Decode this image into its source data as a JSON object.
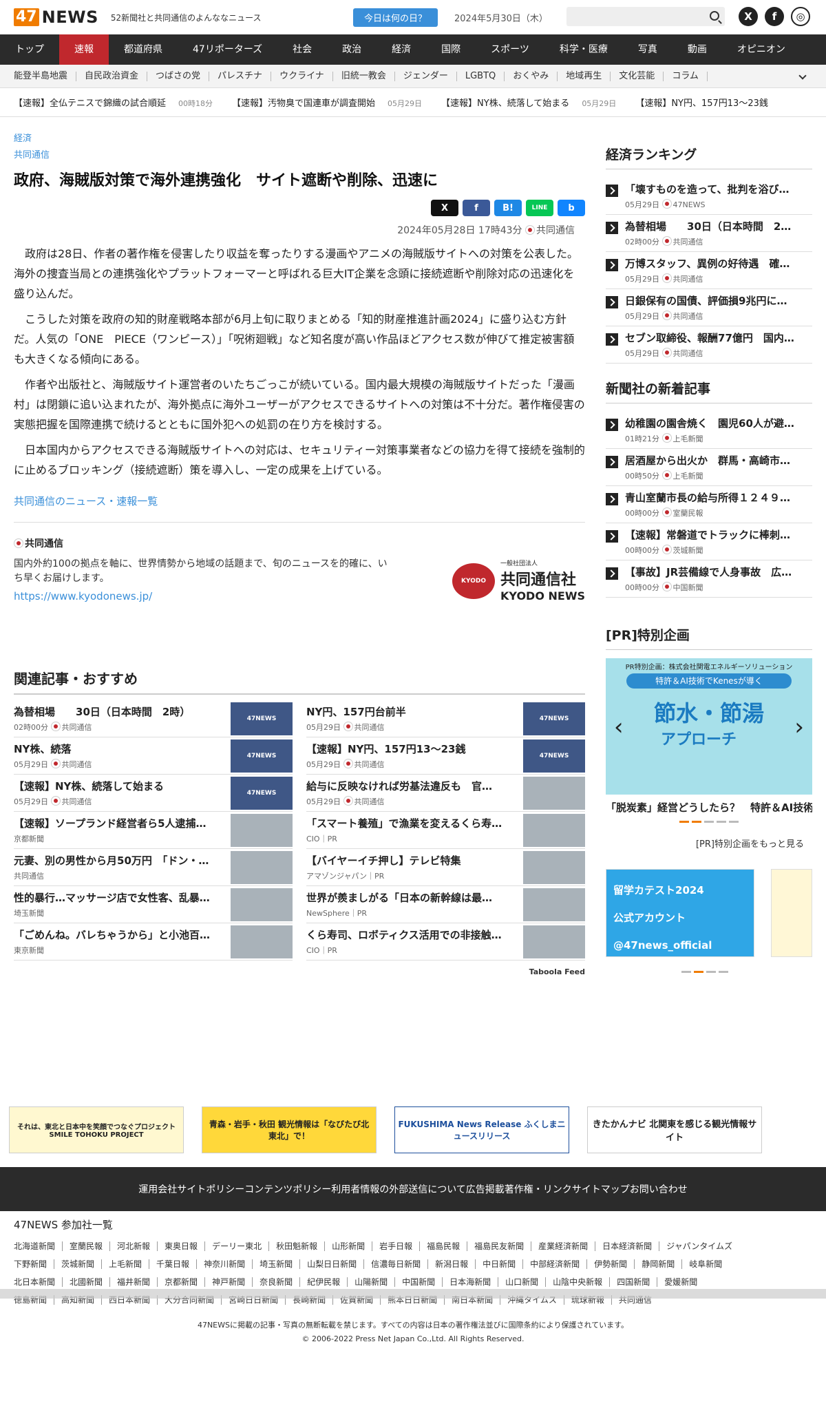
{
  "header": {
    "logo_num": "47",
    "logo_text": "NEWS",
    "tagline": "52新聞社と共同通信のよんななニュース",
    "today_btn": "今日は何の日？",
    "date": "2024年5月30日（木）"
  },
  "nav": [
    "トップ",
    "速報",
    "都道府県",
    "47リポーターズ",
    "社会",
    "政治",
    "経済",
    "国際",
    "スポーツ",
    "科学・医療",
    "写真",
    "動画",
    "オピニオン"
  ],
  "subnav": [
    "能登半島地震",
    "自民政治資金",
    "つばさの党",
    "パレスチナ",
    "ウクライナ",
    "旧統一教会",
    "ジェンダー",
    "LGBTQ",
    "おくやみ",
    "地域再生",
    "文化芸能",
    "コラム"
  ],
  "ticker": [
    {
      "t": "【速報】全仏テニスで錦織の試合順延",
      "m": "00時18分"
    },
    {
      "t": "【速報】汚物臭で国連車が調査開始",
      "m": "05月29日"
    },
    {
      "t": "【速報】NY株、続落して始まる",
      "m": "05月29日"
    },
    {
      "t": "【速報】NY円、157円13〜23銭",
      "m": ""
    }
  ],
  "article": {
    "category": "経済",
    "source_link": "共同通信",
    "title": "政府、海賊版対策で海外連携強化　サイト遮断や削除、迅速に",
    "date": "2024年05月28日 17時43分",
    "source": "共同通信",
    "paragraphs": [
      "政府は28日、作者の著作権を侵害したり収益を奪ったりする漫画やアニメの海賊版サイトへの対策を公表した。海外の捜査当局との連携強化やプラットフォーマーと呼ばれる巨大IT企業を念頭に接続遮断や削除対応の迅速化を盛り込んだ。",
      "こうした対策を政府の知的財産戦略本部が6月上旬に取りまとめる「知的財産推進計画2024」に盛り込む方針だ。人気の「ONE　PIECE（ワンピース）」「呪術廻戦」など知名度が高い作品ほどアクセス数が伸びて推定被害額も大きくなる傾向にある。",
      "作者や出版社と、海賊版サイト運営者のいたちごっこが続いている。国内最大規模の海賊版サイトだった「漫画村」は閉鎖に追い込まれたが、海外拠点に海外ユーザーがアクセスできるサイトへの対策は不十分だ。著作権侵害の実態把握を国際連携で続けるとともに国外犯への処罰の在り方を検討する。",
      "日本国内からアクセスできる海賊版サイトへの対応は、セキュリティー対策事業者などの協力を得て接続を強制的に止めるブロッキング（接続遮断）策を導入し、一定の成果を上げている。"
    ],
    "more_link": "共同通信のニュース・速報一覧"
  },
  "source_box": {
    "name": "共同通信",
    "desc": "国内外約100の拠点を軸に、世界情勢から地域の話題まで、旬のニュースを的確に、いち早くお届けします。",
    "url": "https://www.kyodonews.jp/",
    "logo_badge": "KYODO",
    "logo_small": "一般社団法人",
    "logo_jp": "共同通信社",
    "logo_en": "KYODO NEWS"
  },
  "share": {
    "x": "X",
    "fb": "f",
    "hb": "B!",
    "line": "LINE",
    "bsky": "b"
  },
  "related": {
    "title": "関連記事・おすすめ",
    "items": [
      {
        "t": "為替相場　　30日（日本時間　2時）",
        "m": "02時00分",
        "s": "共同通信"
      },
      {
        "t": "NY円、157円台前半",
        "m": "05月29日",
        "s": "共同通信"
      },
      {
        "t": "NY株、続落",
        "m": "05月29日",
        "s": "共同通信"
      },
      {
        "t": "【速報】NY円、157円13〜23銭",
        "m": "05月29日",
        "s": "共同通信"
      },
      {
        "t": "【速報】NY株、続落して始まる",
        "m": "05月29日",
        "s": "共同通信"
      },
      {
        "t": "給与に反映なければ労基法違反も　官…",
        "m": "05月29日",
        "s": "共同通信"
      },
      {
        "t": "【速報】ソープランド経営者ら5人逮捕…",
        "m": "",
        "s": "京都新聞"
      },
      {
        "t": "「スマート養殖」で漁業を変えるくら寿…",
        "m": "",
        "s": "CIO｜PR"
      },
      {
        "t": "元妻、別の男性から月50万円　「ドン・…",
        "m": "",
        "s": "共同通信"
      },
      {
        "t": "【バイヤーイチ押し】テレビ特集",
        "m": "",
        "s": "アマゾンジャパン｜PR"
      },
      {
        "t": "性的暴行…マッサージ店で女性客、乱暴…",
        "m": "",
        "s": "埼玉新聞"
      },
      {
        "t": "世界が羨ましがる「日本の新幹線は最…",
        "m": "",
        "s": "NewSphere｜PR"
      },
      {
        "t": "「ごめんね。バレちゃうから」と小池百…",
        "m": "",
        "s": "東京新聞"
      },
      {
        "t": "くら寿司、ロボティクス活用での非接触…",
        "m": "",
        "s": "CIO｜PR"
      }
    ],
    "taboola": "Taboola Feed"
  },
  "ranking": {
    "title": "経済ランキング",
    "items": [
      {
        "t": "「壊すものを造って、批判を浴び…",
        "m": "05月29日",
        "s": "47NEWS"
      },
      {
        "t": "為替相場　　30日（日本時間　2…",
        "m": "02時00分",
        "s": "共同通信"
      },
      {
        "t": "万博スタッフ、異例の好待遇　確…",
        "m": "05月29日",
        "s": "共同通信"
      },
      {
        "t": "日銀保有の国債、評価損9兆円に…",
        "m": "05月29日",
        "s": "共同通信"
      },
      {
        "t": "セブン取締役、報酬77億円　国内…",
        "m": "05月29日",
        "s": "共同通信"
      }
    ]
  },
  "newest": {
    "title": "新聞社の新着記事",
    "items": [
      {
        "t": "幼稚園の園舎焼く　園児60人が避…",
        "m": "01時21分",
        "s": "上毛新聞"
      },
      {
        "t": "居酒屋から出火か　群馬・高崎市…",
        "m": "00時50分",
        "s": "上毛新聞"
      },
      {
        "t": "青山室蘭市長の給与所得１２４９…",
        "m": "00時00分",
        "s": "室蘭民報"
      },
      {
        "t": "【速報】常磐道でトラックに棒刺…",
        "m": "00時00分",
        "s": "茨城新聞"
      },
      {
        "t": "【事故】JR芸備線で人身事故　広…",
        "m": "00時00分",
        "s": "中国新聞"
      }
    ]
  },
  "pr": {
    "title": "[PR]特別企画",
    "top": "PR特別企画：株式会社関電エネルギーソリューション",
    "band": "特許＆AI技術でKenesが導く",
    "big": "節水・節湯",
    "sm": "アプローチ",
    "caption": "「脱炭素」経営どうしたら？　特許＆AI技術でKenesが導く節水・節湯ア…",
    "more": "[PR]特別企画をもっと見る"
  },
  "side_banners": [
    "留学カテスト2024",
    "公式アカウント @47news_official"
  ],
  "footer_banners": [
    "それは、東北と日本中を笑顔でつなぐプロジェクト SMILE TOHOKU PROJECT",
    "青森・岩手・秋田 観光情報は「なびたび北東北」で！",
    "FUKUSHIMA News Release ふくしまニュースリリース",
    "きたかんナビ 北関東を感じる観光情報サイト"
  ],
  "footer_links": [
    "運用会社",
    "サイトポリシー",
    "コンテンツポリシー",
    "利用者情報の外部送信について",
    "広告掲載",
    "著作権・リンク",
    "サイトマップ",
    "お問い合わせ"
  ],
  "members": {
    "title": "47NEWS 参加社一覧",
    "rows": [
      [
        "北海道新聞",
        "室蘭民報",
        "河北新報",
        "東奥日報",
        "デーリー東北",
        "秋田魁新報",
        "山形新聞",
        "岩手日報",
        "福島民報",
        "福島民友新聞",
        "産業経済新聞",
        "日本経済新聞",
        "ジャパンタイムズ"
      ],
      [
        "下野新聞",
        "茨城新聞",
        "上毛新聞",
        "千葉日報",
        "神奈川新聞",
        "埼玉新聞",
        "山梨日日新聞",
        "信濃毎日新聞",
        "新潟日報",
        "中日新聞",
        "中部経済新聞",
        "伊勢新聞",
        "静岡新聞",
        "岐阜新聞"
      ],
      [
        "北日本新聞",
        "北國新聞",
        "福井新聞",
        "京都新聞",
        "神戸新聞",
        "奈良新聞",
        "紀伊民報",
        "山陽新聞",
        "中国新聞",
        "日本海新聞",
        "山口新聞",
        "山陰中央新報",
        "四国新聞",
        "愛媛新聞"
      ],
      [
        "徳島新聞",
        "高知新聞",
        "西日本新聞",
        "大分合同新聞",
        "宮崎日日新聞",
        "長崎新聞",
        "佐賀新聞",
        "熊本日日新聞",
        "南日本新聞",
        "沖縄タイムス",
        "琉球新報",
        "共同通信"
      ]
    ]
  },
  "copyright": [
    "47NEWSに掲載の記事・写真の無断転載を禁じます。すべての内容は日本の著作権法並びに国際条約により保護されています。",
    "© 2006-2022 Press Net Japan Co.,Ltd. All Rights Reserved."
  ]
}
